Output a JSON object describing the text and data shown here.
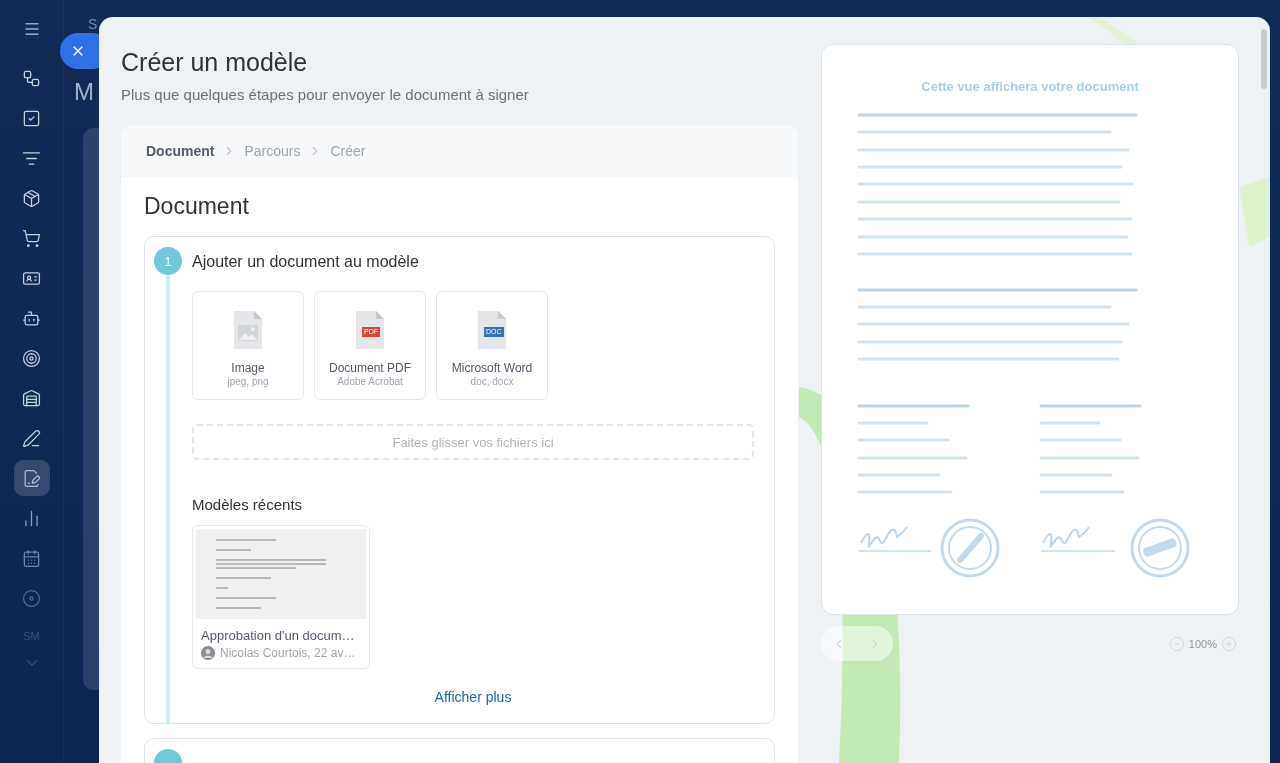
{
  "sidebar": {
    "items": [
      {
        "selected": false
      },
      {
        "selected": false
      },
      {
        "selected": false
      },
      {
        "selected": false
      },
      {
        "selected": false
      },
      {
        "selected": false
      },
      {
        "selected": false
      },
      {
        "selected": false
      },
      {
        "selected": false
      },
      {
        "selected": false
      },
      {
        "selected": true
      },
      {
        "selected": false
      },
      {
        "selected": false
      },
      {
        "selected": false
      }
    ],
    "user_initials": "SM"
  },
  "behind_page": {
    "text_1": "S",
    "text_2": "M"
  },
  "modal": {
    "title": "Créer un modèle",
    "subtitle": "Plus que quelques étapes pour envoyer le document à signer"
  },
  "breadcrumbs": [
    {
      "label": "Document",
      "selected": true
    },
    {
      "label": "Parcours",
      "selected": false
    },
    {
      "label": "Créer",
      "selected": false
    }
  ],
  "section_title": "Document",
  "step": {
    "number": "1",
    "title": "Ajouter un document au modèle"
  },
  "file_types": [
    {
      "kind": "image",
      "title": "Image",
      "subtitle": "jpeg, png"
    },
    {
      "kind": "pdf",
      "badge": "PDF",
      "title": "Document PDF",
      "subtitle": "Adobe Acrobat"
    },
    {
      "kind": "doc",
      "badge": "DOC",
      "title": "Microsoft Word",
      "subtitle": "doc, docx"
    }
  ],
  "drop_zone": {
    "placeholder": "Faites glisser vos fichiers ici"
  },
  "recent": {
    "title": "Modèles récents",
    "templates": [
      {
        "name": "Approbation d'un docum…",
        "author": "Nicolas Courtois, 22 av…"
      }
    ],
    "more_link": "Afficher plus"
  },
  "preview": {
    "title": "Cette vue affichera votre document",
    "zoom": "100%"
  }
}
